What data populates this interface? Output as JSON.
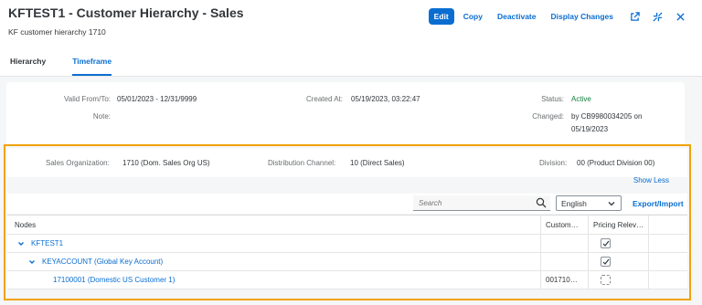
{
  "header": {
    "title": "KFTEST1 - Customer Hierarchy - Sales",
    "subtitle": "KF customer hierarchy 1710",
    "actions": {
      "edit": "Edit",
      "copy": "Copy",
      "deactivate": "Deactivate",
      "display_changes": "Display Changes"
    },
    "icons": [
      "open-new-window-icon",
      "exit-full-screen-icon",
      "close-icon"
    ]
  },
  "tabs": [
    {
      "label": "Hierarchy",
      "active": false
    },
    {
      "label": "Timeframe",
      "active": true
    }
  ],
  "details": {
    "valid_label": "Valid From/To:",
    "valid_value": "05/01/2023 - 12/31/9999",
    "note_label": "Note:",
    "note_value": "",
    "created_label": "Created At:",
    "created_value": "05/19/2023, 03:22:47",
    "status_label": "Status:",
    "status_value": "Active",
    "changed_label": "Changed:",
    "changed_value_line1": "by CB9980034205 on",
    "changed_value_line2": "05/19/2023"
  },
  "filters": {
    "sales_org_label": "Sales Organization:",
    "sales_org_value": "1710 (Dom. Sales Org US)",
    "dist_channel_label": "Distribution Channel:",
    "dist_channel_value": "10 (Direct Sales)",
    "division_label": "Division:",
    "division_value": "00 (Product Division 00)",
    "show_less": "Show Less"
  },
  "toolbar": {
    "search_placeholder": "Search",
    "language_value": "English",
    "export_import": "Export/Import"
  },
  "table": {
    "columns": [
      "Nodes",
      "Custom…",
      "Pricing Relev…",
      ""
    ],
    "rows": [
      {
        "node": "KFTEST1",
        "level": 0,
        "expanded": true,
        "customer": "",
        "pricing_checked": true
      },
      {
        "node": "KEYACCOUNT (Global Key Account)",
        "level": 1,
        "expanded": true,
        "customer": "",
        "pricing_checked": true
      },
      {
        "node": "17100001 (Domestic US Customer 1)",
        "level": 2,
        "expanded": false,
        "customer": "001710…",
        "pricing_checked": false
      }
    ]
  },
  "colors": {
    "accent": "#0a6ed1",
    "highlight_frame": "#f0a30a",
    "status_active": "#107e3e"
  }
}
